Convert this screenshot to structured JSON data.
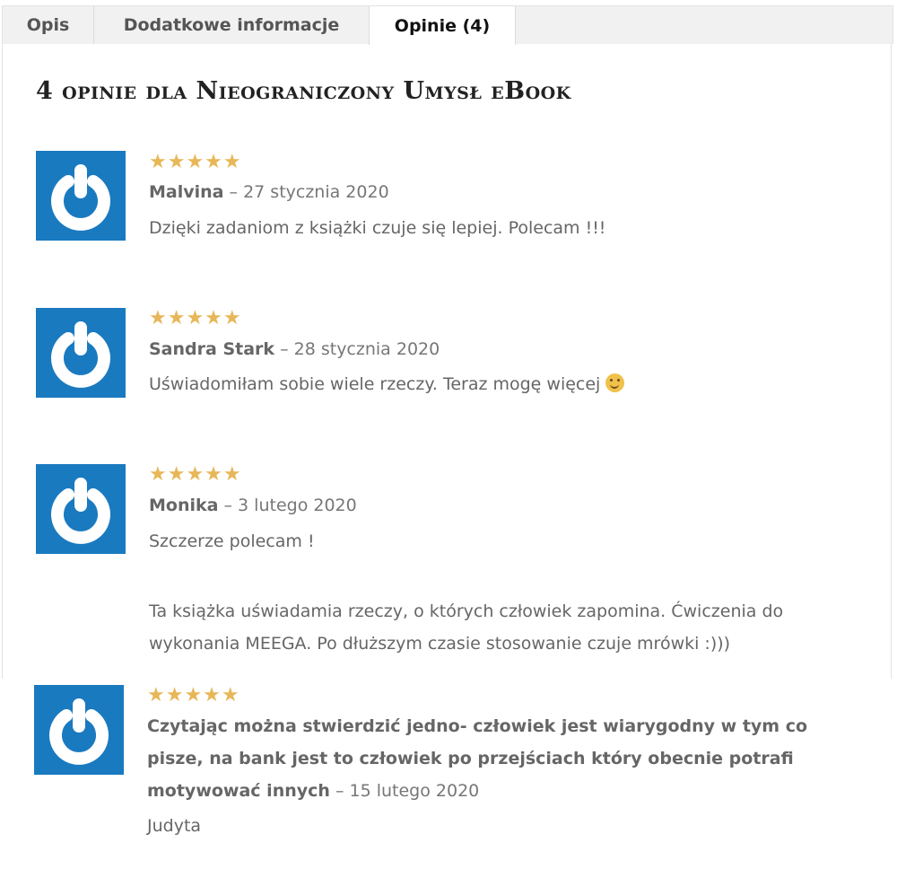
{
  "tabs": [
    {
      "label": "Opis"
    },
    {
      "label": "Dodatkowe informacje"
    },
    {
      "label": "Opinie (4)"
    }
  ],
  "reviews_heading": "4 opinie dla Nieograniczony Umysł eBook",
  "reviews": [
    {
      "rating": 5,
      "stars": "★★★★★",
      "author": "Malvina",
      "date": " – 27 stycznia 2020",
      "text": [
        "Dzięki zadaniom z książki czuje się lepiej. Polecam !!!"
      ]
    },
    {
      "rating": 5,
      "stars": "★★★★★",
      "author": "Sandra Stark",
      "date": " – 28 stycznia 2020",
      "text": [
        "Uświadomiłam sobie wiele rzeczy. Teraz mogę więcej"
      ]
    },
    {
      "rating": 5,
      "stars": "★★★★★",
      "author": "Monika",
      "date": " – 3 lutego 2020",
      "text": [
        "Szczerze polecam !",
        "Ta książka uświadamia rzeczy, o których człowiek zapomina. Ćwiczenia do",
        "wykonania MEEGA. Po dłuższym czasie stosowanie czuje mrówki :)))"
      ]
    },
    {
      "rating": 5,
      "stars": "★★★★★",
      "author_lines": [
        "Czytając można stwierdzić jedno- człowiek jest wiarygodny w tym co",
        "pisze, na bank jest to człowiek po przejściach który obecnie potrafi",
        "motywować innych"
      ],
      "date": " – 15 lutego 2020",
      "text": [
        "Judyta"
      ]
    }
  ],
  "colors": {
    "star": "#e7b758",
    "avatar_bg": "#1a7ac0",
    "tab_bg": "#f1f1f1"
  },
  "icons": {
    "avatar": "gravatar-icon",
    "emoji": "slightly-smiling-face-icon"
  }
}
